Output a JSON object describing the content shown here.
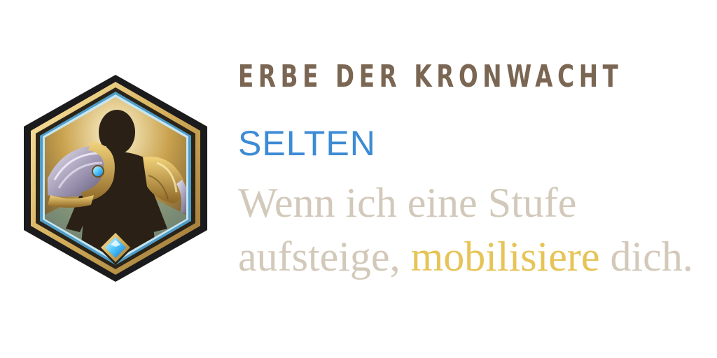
{
  "augment": {
    "title": "ERBE DER KRONWACHT",
    "rarity": "SELTEN",
    "description": {
      "before": "Wenn ich eine Stufe aufsteige,",
      "highlight": "mobilisiere",
      "after": "dich."
    },
    "icon": "golden-pauldron-armor-icon",
    "gem_icon": "blue-diamond-gem-icon"
  },
  "colors": {
    "title": "#7a6652",
    "rarity": "#3d8bd4",
    "description": "#d2c9ba",
    "highlight": "#e6c457"
  }
}
